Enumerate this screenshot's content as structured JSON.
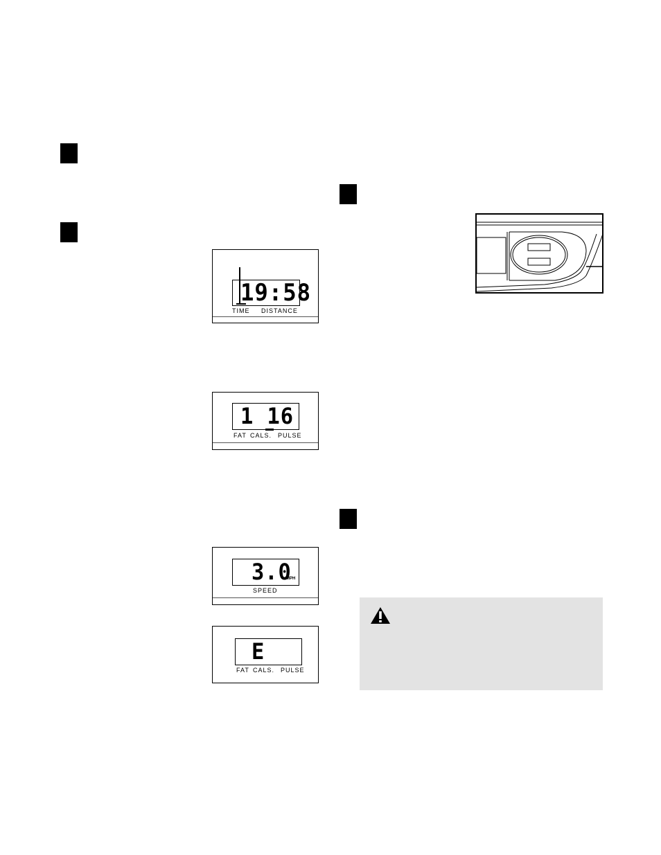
{
  "steps": [
    {
      "id": "step-a",
      "label": ""
    },
    {
      "id": "step-b",
      "label": ""
    },
    {
      "id": "step-c",
      "label": ""
    },
    {
      "id": "step-d",
      "label": ""
    }
  ],
  "displays": {
    "time_distance": {
      "value": "19:58",
      "labels": [
        "TIME",
        "DISTANCE"
      ]
    },
    "fat_cals_pulse_1": {
      "value": "1 16",
      "labels": [
        "FAT",
        "CALS.",
        "PULSE"
      ]
    },
    "speed": {
      "value": "3.0",
      "unit": "MPH",
      "labels": [
        "SPEED"
      ]
    },
    "fat_cals_pulse_2": {
      "value": "E",
      "labels": [
        "FAT",
        "CALS.",
        "PULSE"
      ]
    }
  },
  "warning": {
    "icon": "warning-triangle-icon",
    "text": ""
  },
  "illustration": {
    "name": "key-clip-illustration"
  }
}
